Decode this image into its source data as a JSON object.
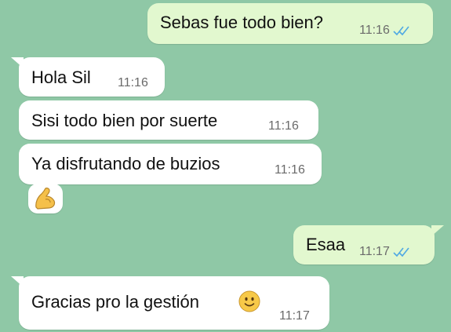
{
  "messages": [
    {
      "text": "Sebas fue todo bien?",
      "time": "11:16",
      "direction": "outgoing",
      "read": true
    },
    {
      "text": "Hola Sil",
      "time": "11:16",
      "direction": "incoming"
    },
    {
      "text": "Sisi todo bien por suerte",
      "time": "11:16",
      "direction": "incoming"
    },
    {
      "text": "Ya disfrutando de buzios",
      "time": "11:16",
      "direction": "incoming"
    },
    {
      "emoji": "flexed-biceps",
      "direction": "incoming"
    },
    {
      "text": "Esaa",
      "time": "11:17",
      "direction": "outgoing",
      "read": true
    },
    {
      "text": "Gracias pro la gestión",
      "emoji": "smiling-face",
      "time": "11:17",
      "direction": "incoming"
    }
  ],
  "colors": {
    "background": "#8fc8a6",
    "incoming_bubble": "#ffffff",
    "outgoing_bubble": "#e2f8cf",
    "read_ticks": "#4fa9e3",
    "timestamp": "#6b6b6b"
  }
}
